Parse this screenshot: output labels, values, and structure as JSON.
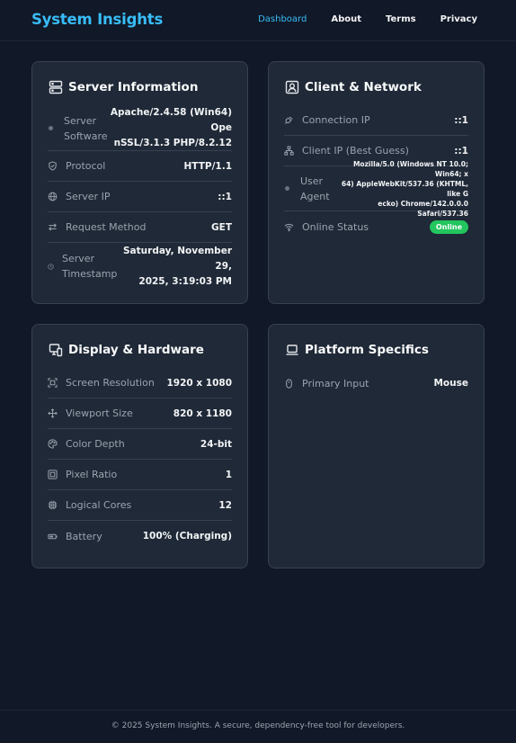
{
  "brand": "System Insights",
  "nav": [
    {
      "label": "Dashboard"
    },
    {
      "label": "About"
    },
    {
      "label": "Terms"
    },
    {
      "label": "Privacy"
    }
  ],
  "server": {
    "title": "Server Information",
    "title_icon": "server-icon",
    "rows": [
      {
        "label_1": "Server",
        "label_2": "Software",
        "value_1": "Apache/2.4.58 (Win64) Ope",
        "value_2": "nSSL/3.1.3 PHP/8.2.12",
        "icon": "dot-icon"
      },
      {
        "label": "Protocol",
        "value": "HTTP/1.1",
        "icon": "shield-icon"
      },
      {
        "label": "Server IP",
        "value": "::1",
        "icon": "globe-icon"
      },
      {
        "label": "Request Method",
        "value": "GET",
        "icon": "arrows-exchange-icon"
      },
      {
        "label_1": "Server",
        "label_2": "Timestamp",
        "value_1": "Saturday, November 29,",
        "value_2": "2025, 3:19:03 PM",
        "icon": "clock-icon"
      }
    ]
  },
  "client": {
    "title": "Client & Network",
    "title_icon": "user-badge-icon",
    "rows": [
      {
        "label": "Connection IP",
        "value": "::1",
        "icon": "plug-icon"
      },
      {
        "label": "Client IP (Best Guess)",
        "value": "::1",
        "icon": "network-icon"
      },
      {
        "label_1": "User",
        "label_2": "Agent",
        "value_1": "Mozilla/5.0 (Windows NT 10.0; Win64; x",
        "value_2": "64) AppleWebKit/537.36 (KHTML, like G",
        "value_3": "ecko) Chrome/142.0.0.0 Safari/537.36",
        "icon": "dot-icon"
      },
      {
        "label": "Online Status",
        "value": "Online",
        "icon": "wifi-icon",
        "status_color": "#22c55e"
      }
    ]
  },
  "display": {
    "title": "Display & Hardware",
    "title_icon": "devices-icon",
    "rows": [
      {
        "label": "Screen Resolution",
        "value": "1920 x 1080",
        "icon": "screen-icon"
      },
      {
        "label": "Viewport Size",
        "value": "820 x 1180",
        "icon": "move-icon"
      },
      {
        "label": "Color Depth",
        "value": "24-bit",
        "icon": "palette-icon"
      },
      {
        "label": "Pixel Ratio",
        "value": "1",
        "icon": "grid-icon"
      },
      {
        "label": "Logical Cores",
        "value": "12",
        "icon": "cpu-icon"
      },
      {
        "label": "Battery",
        "value": "100% (Charging)",
        "icon": "battery-icon"
      }
    ]
  },
  "platform": {
    "title": "Platform Specifics",
    "title_icon": "laptop-icon",
    "rows": [
      {
        "label": "Primary Input",
        "value": "Mouse",
        "icon": "mouse-icon"
      }
    ]
  },
  "footer": "© 2025 System Insights. A secure, dependency-free tool for developers.",
  "colors": {
    "background": "#111827",
    "card": "#1f2937",
    "border": "#374151",
    "accent": "#38bdf8",
    "online": "#22c55e"
  }
}
